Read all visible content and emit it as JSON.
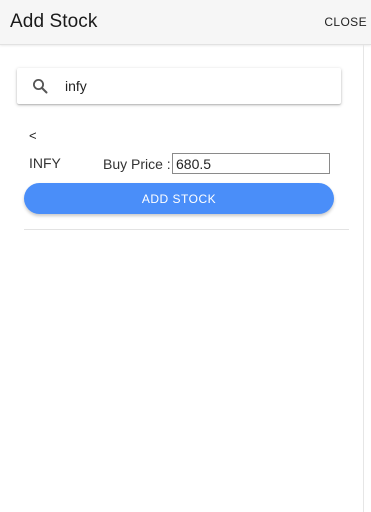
{
  "header": {
    "title": "Add Stock",
    "close_label": "CLOSE"
  },
  "search": {
    "icon": "search-icon",
    "value": "infy"
  },
  "result": {
    "back_label": "<",
    "symbol": "INFY",
    "buy_price_label": "Buy Price :",
    "buy_price_value": "680.5",
    "add_button_label": "ADD STOCK"
  },
  "colors": {
    "accent": "#4a8ef9",
    "header_bg": "#f6f6f6"
  }
}
